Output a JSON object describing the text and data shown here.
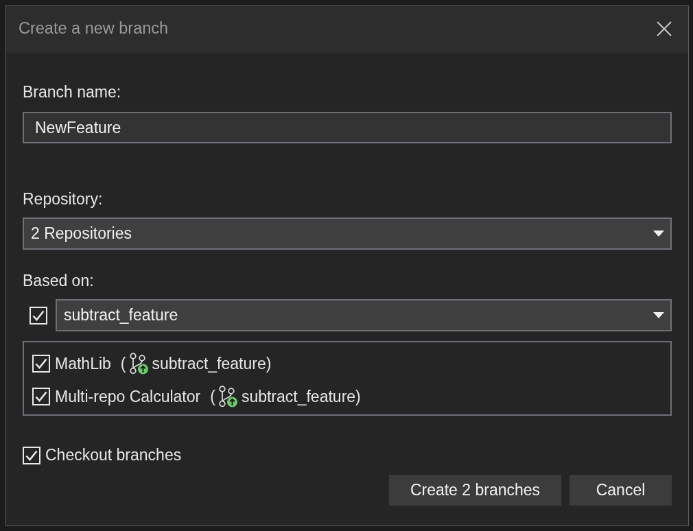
{
  "dialog": {
    "title": "Create a new branch"
  },
  "branch_name": {
    "label": "Branch name:",
    "value": "NewFeature"
  },
  "repository": {
    "label": "Repository:",
    "value": "2 Repositories"
  },
  "based_on": {
    "label": "Based on:",
    "checked": true,
    "value": "subtract_feature"
  },
  "repositories": [
    {
      "name": "MathLib",
      "checked": true,
      "paren": "(",
      "branch": "subtract_feature)"
    },
    {
      "name": "Multi-repo Calculator",
      "checked": true,
      "paren": "(",
      "branch": "subtract_feature)"
    }
  ],
  "checkout_branches": {
    "label": "Checkout branches",
    "checked": true
  },
  "buttons": [
    {
      "label": "Create 2 branches"
    },
    {
      "label": "Cancel"
    }
  ]
}
